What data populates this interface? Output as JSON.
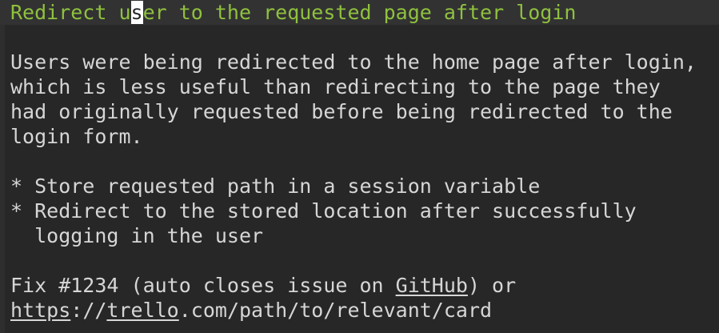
{
  "editor": {
    "subject": {
      "before_cursor": "Redirect u",
      "cursor_char": "s",
      "after_cursor": "er to the requested page after login"
    },
    "body": [
      "Users were being redirected to the home page after login,",
      "which is less useful than redirecting to the page they",
      "had originally requested before being redirected to the",
      "login form."
    ],
    "bullets": [
      "* Store requested path in a session variable",
      "* Redirect to the stored location after successfully",
      "  logging in the user"
    ],
    "footer": {
      "fix_prefix": "Fix #1234 (auto closes issue on ",
      "github_link": "GitHub",
      "fix_suffix": ") or",
      "url_scheme": "https",
      "url_separator": "://",
      "url_host": "trello",
      "url_rest": ".com/path/to/relevant/card"
    }
  },
  "colors": {
    "background": "#272727",
    "text": "#d6d6d6",
    "subject": "#8fc13e",
    "cursor": "#ffffff"
  }
}
